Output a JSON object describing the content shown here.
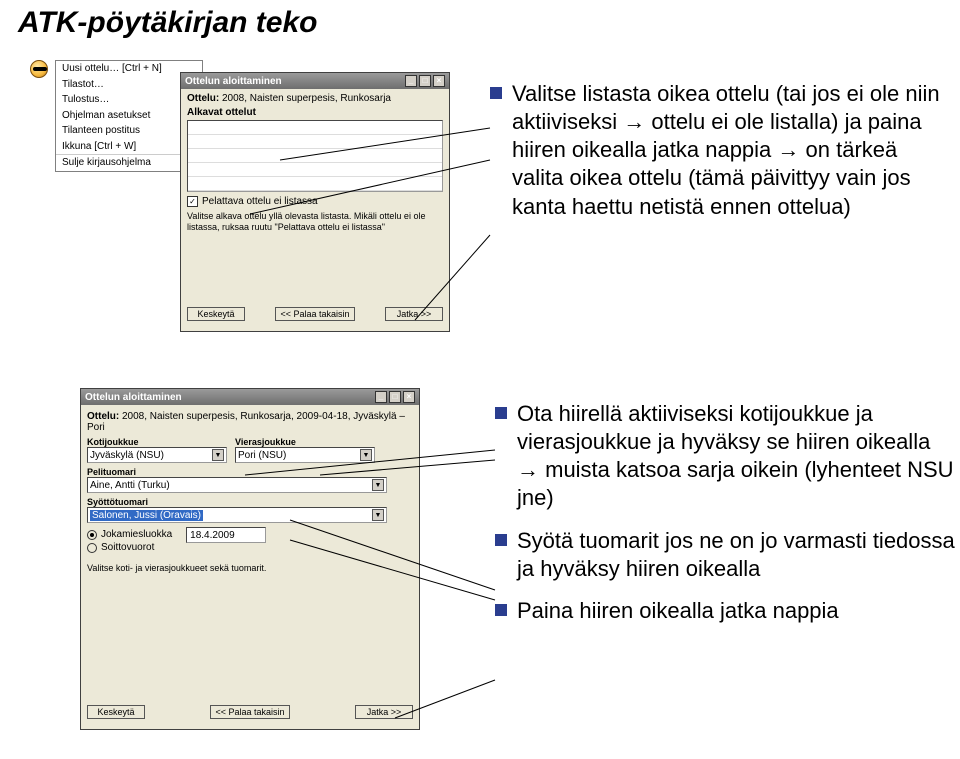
{
  "page_title": "ATK-pöytäkirjan teko",
  "menu": {
    "items": [
      "Uusi ottelu… [Ctrl + N]",
      "Tilastot…",
      "Tulostus…",
      "Ohjelman asetukset",
      "Tilanteen postitus",
      "Ikkuna [Ctrl + W]",
      "Sulje kirjausohjelma"
    ]
  },
  "dlg1": {
    "title": "Ottelun aloittaminen",
    "ottelu_label": "Ottelu:",
    "ottelu_value": "2008, Naisten superpesis, Runkosarja",
    "list_label": "Alkavat ottelut",
    "chk_label": "Pelattava ottelu ei listassa",
    "help": "Valitse alkava ottelu yllä olevasta listasta. Mikäli ottelu ei ole listassa, ruksaa ruutu \"Pelattava ottelu ei listassa\"",
    "btn_cancel": "Keskeytä",
    "btn_back": "<< Palaa takaisin",
    "btn_next": "Jatka >>"
  },
  "bullets_top": {
    "text": "Valitse listasta oikea ottelu (tai jos ei ole niin aktiiviseksi → ottelu ei ole listalla) ja paina hiiren oikealla jatka nappia → on tärkeä valita oikea ottelu (tämä päivittyy vain jos kanta haettu netistä ennen ottelua)"
  },
  "bullets_bottom": [
    "Ota hiirellä aktiiviseksi kotijoukkue ja vierasjoukkue ja hyväksy se hiiren oikealla → muista katsoa sarja oikein (lyhenteet NSU jne)",
    "Syötä tuomarit jos ne on jo varmasti tiedossa ja hyväksy hiiren oikealla",
    "Paina hiiren oikealla jatka nappia"
  ],
  "dlg2": {
    "title": "Ottelun aloittaminen",
    "ottelu_label": "Ottelu:",
    "ottelu_value": "2008, Naisten superpesis, Runkosarja, 2009-04-18, Jyväskylä – Pori",
    "koti_label": "Kotijoukkue",
    "koti_value": "Jyväskylä (NSU)",
    "vieras_label": "Vierasjoukkue",
    "vieras_value": "Pori (NSU)",
    "pel_label": "Pelituomari",
    "pel_value": "Aine, Antti (Turku)",
    "syt_label": "Syöttötuomari",
    "syt_value": "Salonen, Jussi (Oravais)",
    "radio1": "Jokamiesluokka",
    "radio2": "Soittovuorot",
    "date_value": "18.4.2009",
    "instr": "Valitse koti- ja vierasjoukkueet sekä tuomarit.",
    "btn_cancel": "Keskeytä",
    "btn_back": "<< Palaa takaisin",
    "btn_next": "Jatka >>"
  }
}
